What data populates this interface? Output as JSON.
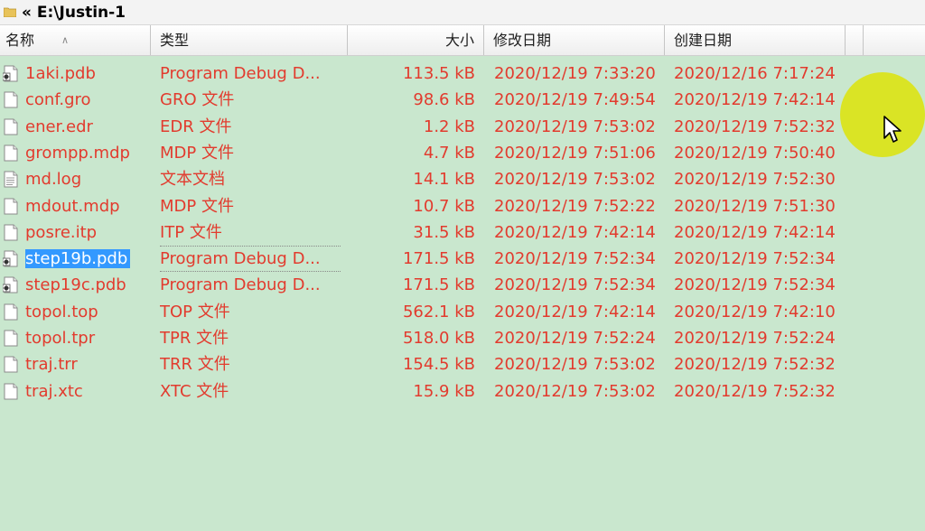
{
  "titlebar": {
    "path": "« E:\\Justin-1"
  },
  "columns": {
    "name": "名称",
    "type": "类型",
    "size": "大小",
    "modified": "修改日期",
    "created": "创建日期"
  },
  "files": [
    {
      "name": "1aki.pdb",
      "type": "Program Debug D...",
      "size": "113.5 kB",
      "modified": "2020/12/19 7:33:20",
      "created": "2020/12/16 7:17:24",
      "icon": "pdb-file-icon"
    },
    {
      "name": "conf.gro",
      "type": "GRO 文件",
      "size": "98.6 kB",
      "modified": "2020/12/19 7:49:54",
      "created": "2020/12/19 7:42:14",
      "icon": "blank-file-icon"
    },
    {
      "name": "ener.edr",
      "type": "EDR 文件",
      "size": "1.2 kB",
      "modified": "2020/12/19 7:53:02",
      "created": "2020/12/19 7:52:32",
      "icon": "blank-file-icon"
    },
    {
      "name": "grompp.mdp",
      "type": "MDP 文件",
      "size": "4.7 kB",
      "modified": "2020/12/19 7:51:06",
      "created": "2020/12/19 7:50:40",
      "icon": "blank-file-icon"
    },
    {
      "name": "md.log",
      "type": "文本文档",
      "size": "14.1 kB",
      "modified": "2020/12/19 7:53:02",
      "created": "2020/12/19 7:52:30",
      "icon": "text-file-icon"
    },
    {
      "name": "mdout.mdp",
      "type": "MDP 文件",
      "size": "10.7 kB",
      "modified": "2020/12/19 7:52:22",
      "created": "2020/12/19 7:51:30",
      "icon": "blank-file-icon"
    },
    {
      "name": "posre.itp",
      "type": "ITP 文件",
      "size": "31.5 kB",
      "modified": "2020/12/19 7:42:14",
      "created": "2020/12/19 7:42:14",
      "icon": "blank-file-icon"
    },
    {
      "name": "step19b.pdb",
      "type": "Program Debug D...",
      "size": "171.5 kB",
      "modified": "2020/12/19 7:52:34",
      "created": "2020/12/19 7:52:34",
      "icon": "pdb-file-icon",
      "selected": true
    },
    {
      "name": "step19c.pdb",
      "type": "Program Debug D...",
      "size": "171.5 kB",
      "modified": "2020/12/19 7:52:34",
      "created": "2020/12/19 7:52:34",
      "icon": "pdb-file-icon"
    },
    {
      "name": "topol.top",
      "type": "TOP 文件",
      "size": "562.1 kB",
      "modified": "2020/12/19 7:42:14",
      "created": "2020/12/19 7:42:10",
      "icon": "blank-file-icon"
    },
    {
      "name": "topol.tpr",
      "type": "TPR 文件",
      "size": "518.0 kB",
      "modified": "2020/12/19 7:52:24",
      "created": "2020/12/19 7:52:24",
      "icon": "blank-file-icon"
    },
    {
      "name": "traj.trr",
      "type": "TRR 文件",
      "size": "154.5 kB",
      "modified": "2020/12/19 7:53:02",
      "created": "2020/12/19 7:52:32",
      "icon": "blank-file-icon"
    },
    {
      "name": "traj.xtc",
      "type": "XTC 文件",
      "size": "15.9 kB",
      "modified": "2020/12/19 7:53:02",
      "created": "2020/12/19 7:52:32",
      "icon": "blank-file-icon"
    }
  ],
  "colors": {
    "list_background": "#c9e7ce",
    "text": "#e23b2e",
    "selection": "#3399ff",
    "cursor_highlight": "#dbe41b"
  }
}
